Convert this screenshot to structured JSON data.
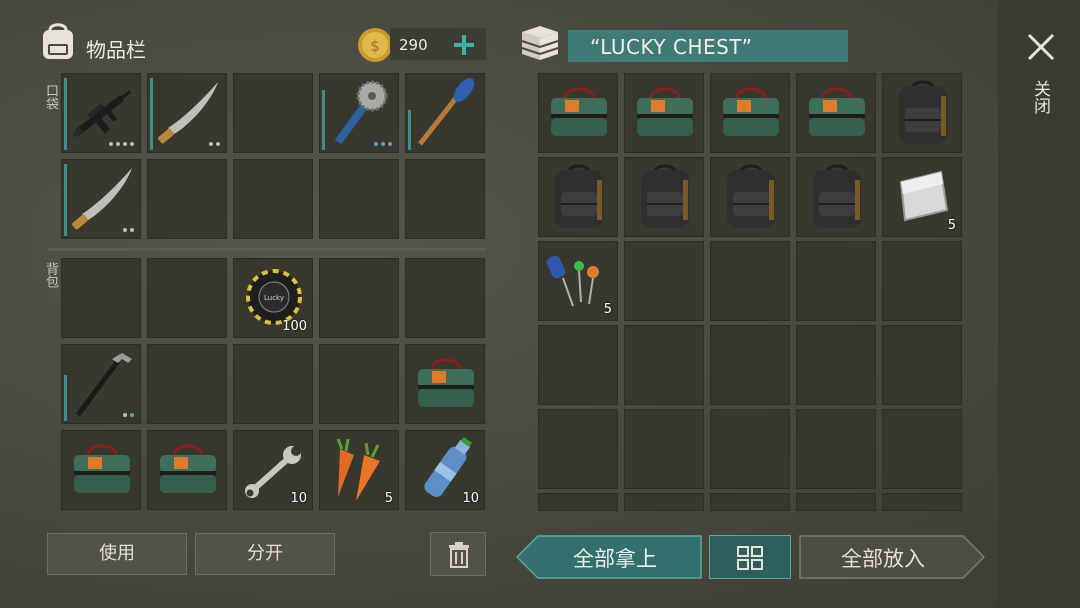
{
  "inventory": {
    "title": "物品栏",
    "coins": "290",
    "pocket_label": "口袋",
    "backpack_label": "背包",
    "use_button": "使用",
    "split_button": "分开"
  },
  "chest": {
    "title": "“LUCKY CHEST”",
    "close_label": "关闭",
    "take_all_button": "全部拿上",
    "put_all_button": "全部放入"
  },
  "item_quantities": {
    "lucky_chip": "100",
    "wrench": "10",
    "carrots": "5",
    "water_bottle": "10",
    "chest_sheet_metal": "5",
    "chest_electronics": "5"
  },
  "icons": {
    "backpack": "backpack-icon",
    "coin": "coin-icon",
    "add": "plus-icon",
    "chest": "chest-stack-icon",
    "close": "close-icon",
    "trash": "trash-icon",
    "sort": "sort-grid-icon"
  },
  "colors": {
    "accent_teal": "#3f8c88",
    "header_bar": "#3f7a76",
    "take_all_bg": "#33706d"
  }
}
